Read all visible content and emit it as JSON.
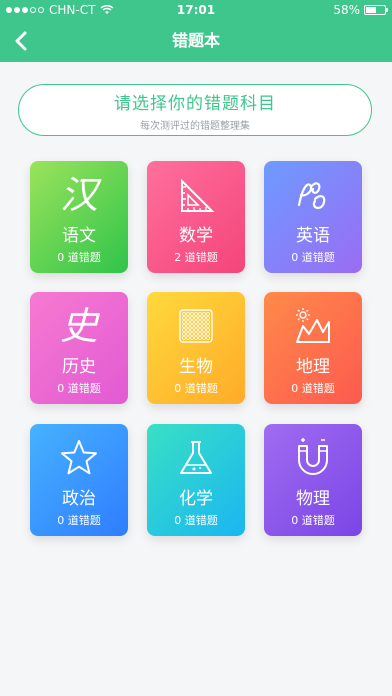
{
  "status_bar": {
    "carrier": "CHN-CT",
    "time": "17:01",
    "battery_text": "58%",
    "battery_level": 0.58
  },
  "nav": {
    "title": "错题本",
    "back_icon": "chevron-left-icon"
  },
  "banner": {
    "title": "请选择你的错题科目",
    "subtitle": "每次测评过的错题整理集"
  },
  "subjects": [
    {
      "name": "语文",
      "count": "0 道错题",
      "icon": "glyph-han",
      "glyph": "汉"
    },
    {
      "name": "数学",
      "count": "2 道错题",
      "icon": "set-square-icon"
    },
    {
      "name": "英语",
      "count": "0 道错题",
      "icon": "abc-script-icon"
    },
    {
      "name": "历史",
      "count": "0 道错题",
      "icon": "glyph-shi",
      "glyph": "史"
    },
    {
      "name": "生物",
      "count": "0 道错题",
      "icon": "cell-grid-icon"
    },
    {
      "name": "地理",
      "count": "0 道错题",
      "icon": "mountain-sun-icon"
    },
    {
      "name": "政治",
      "count": "0 道错题",
      "icon": "star-icon"
    },
    {
      "name": "化学",
      "count": "0 道错题",
      "icon": "flask-icon"
    },
    {
      "name": "物理",
      "count": "0 道错题",
      "icon": "magnet-icon"
    }
  ],
  "colors": {
    "accent": "#3ec68c",
    "chinese": "#2fc44a",
    "math": "#f4457a",
    "english": "#8a7cf7",
    "history": "#e25ad3",
    "biology": "#ffab29",
    "geography": "#fd5a4f",
    "politics": "#2f7dff",
    "chemistry": "#1ab6f2",
    "physics": "#7a45e6"
  }
}
